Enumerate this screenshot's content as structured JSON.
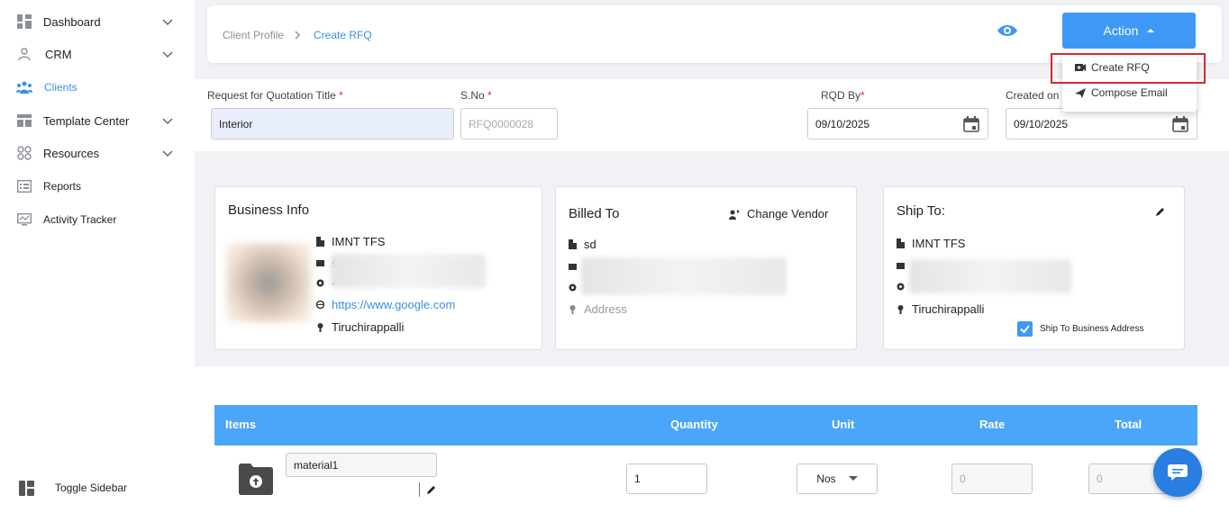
{
  "sidebar": {
    "items": [
      {
        "label": "Dashboard",
        "icon": "dashboard-icon",
        "chevron": true
      },
      {
        "label": "CRM",
        "icon": "crm-icon",
        "chevron": true
      },
      {
        "label": "Clients",
        "icon": "clients-icon",
        "chevron": false,
        "active": true
      },
      {
        "label": "Template Center",
        "icon": "template-icon",
        "chevron": true
      },
      {
        "label": "Resources",
        "icon": "resources-icon",
        "chevron": true
      },
      {
        "label": "Reports",
        "icon": "reports-icon",
        "chevron": false
      },
      {
        "label": "Activity Tracker",
        "icon": "activity-icon",
        "chevron": false
      }
    ],
    "toggle_label": "Toggle Sidebar"
  },
  "header": {
    "breadcrumb": [
      "Client Profile",
      "Create RFQ"
    ],
    "action_label": "Action",
    "menu": [
      "Create RFQ",
      "Compose Email"
    ]
  },
  "form": {
    "title_label": "Request for Quotation Title",
    "title_value": "Interior",
    "sno_label": "S.No",
    "sno_placeholder": "RFQ0000028",
    "rqd_label": "RQD By",
    "rqd_value": "09/10/2025",
    "created_label": "Created on",
    "created_value": "09/10/2025"
  },
  "business": {
    "title": "Business Info",
    "name": "IMNT TFS",
    "email_partial": "s",
    "phone_partial": "-",
    "website": "https://www.google.com",
    "city": "Tiruchirappalli"
  },
  "billed": {
    "title": "Billed To",
    "change_vendor": "Change Vendor",
    "name": "sd",
    "address_placeholder": "Address"
  },
  "ship": {
    "title": "Ship To:",
    "name": "IMNT TFS",
    "city": "Tiruchirappalli",
    "checkbox_label": "Ship To Business Address"
  },
  "items": {
    "headers": [
      "Items",
      "Quantity",
      "Unit",
      "Rate",
      "Total"
    ],
    "row": {
      "material": "material1",
      "quantity": "1",
      "unit": "Nos",
      "rate": "0",
      "total": "0"
    }
  },
  "colors": {
    "accent": "#3d99f5",
    "header": "#4ba5f8",
    "highlight": "#d7282f"
  }
}
